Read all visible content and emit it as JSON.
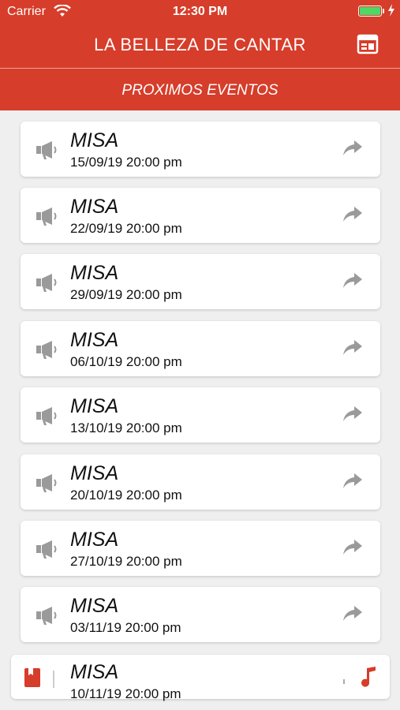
{
  "status_bar": {
    "carrier": "Carrier",
    "time": "12:30 PM"
  },
  "nav": {
    "title": "LA BELLEZA DE CANTAR",
    "right_icon": "calendar-icon"
  },
  "section": {
    "title": "PROXIMOS EVENTOS"
  },
  "events": [
    {
      "name": "MISA",
      "date": "15/09/19 20:00 pm"
    },
    {
      "name": "MISA",
      "date": "22/09/19 20:00 pm"
    },
    {
      "name": "MISA",
      "date": "29/09/19 20:00 pm"
    },
    {
      "name": "MISA",
      "date": "06/10/19 20:00 pm"
    },
    {
      "name": "MISA",
      "date": "13/10/19 20:00 pm"
    },
    {
      "name": "MISA",
      "date": "20/10/19 20:00 pm"
    },
    {
      "name": "MISA",
      "date": "27/10/19 20:00 pm"
    },
    {
      "name": "MISA",
      "date": "03/11/19 20:00 pm"
    },
    {
      "name": "MISA",
      "date": "10/11/19 20:00 pm"
    }
  ],
  "colors": {
    "header": "#d63d2a",
    "battery": "#4cd964",
    "icon_gray": "#9a9a9a"
  },
  "icons": {
    "event": "megaphone-icon",
    "action": "share-arrow-icon",
    "player_left": "book-icon",
    "player_right": "music-note-icon"
  }
}
